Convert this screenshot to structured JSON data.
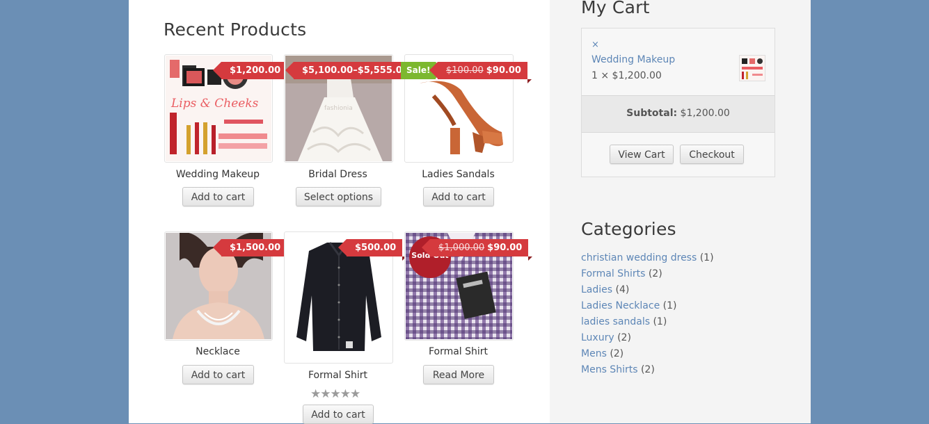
{
  "main": {
    "title": "Recent Products",
    "products": [
      {
        "name": "Wedding Makeup",
        "price": "$1,200.00",
        "button": "Add to cart"
      },
      {
        "name": "Bridal Dress",
        "price": "$5,100.00–$5,555.00",
        "button": "Select options"
      },
      {
        "name": "Ladies Sandals",
        "sale_badge": "Sale!",
        "old_price": "$100.00",
        "price": "$90.00",
        "button": "Add to cart"
      },
      {
        "name": "Necklace",
        "price": "$1,500.00",
        "button": "Add to cart"
      },
      {
        "name": "Formal Shirt",
        "price": "$500.00",
        "rating": "★★★★★",
        "button": "Add to cart"
      },
      {
        "name": "Formal Shirt",
        "sold_out_badge": "Sold Out",
        "old_price": "$1,000.00",
        "price": "$90.00",
        "button": "Read More"
      }
    ]
  },
  "cart": {
    "title": "My Cart",
    "remove_symbol": "×",
    "item_name": "Wedding Makeup",
    "item_qty": "1 × $1,200.00",
    "subtotal_label": "Subtotal:",
    "subtotal_value": "$1,200.00",
    "view_cart": "View Cart",
    "checkout": "Checkout"
  },
  "categories": {
    "title": "Categories",
    "items": [
      {
        "label": "christian wedding dress",
        "count": "(1)"
      },
      {
        "label": "Formal Shirts",
        "count": "(2)"
      },
      {
        "label": "Ladies",
        "count": "(4)"
      },
      {
        "label": "Ladies Necklace",
        "count": "(1)"
      },
      {
        "label": "ladies sandals",
        "count": "(1)"
      },
      {
        "label": "Luxury",
        "count": "(2)"
      },
      {
        "label": "Mens",
        "count": "(2)"
      },
      {
        "label": "Mens Shirts",
        "count": "(2)"
      }
    ]
  },
  "colors": {
    "link": "#5d86b6",
    "price_tag": "#d53a3e",
    "sale_badge": "#7cb82f",
    "background": "#6b8fb5"
  }
}
